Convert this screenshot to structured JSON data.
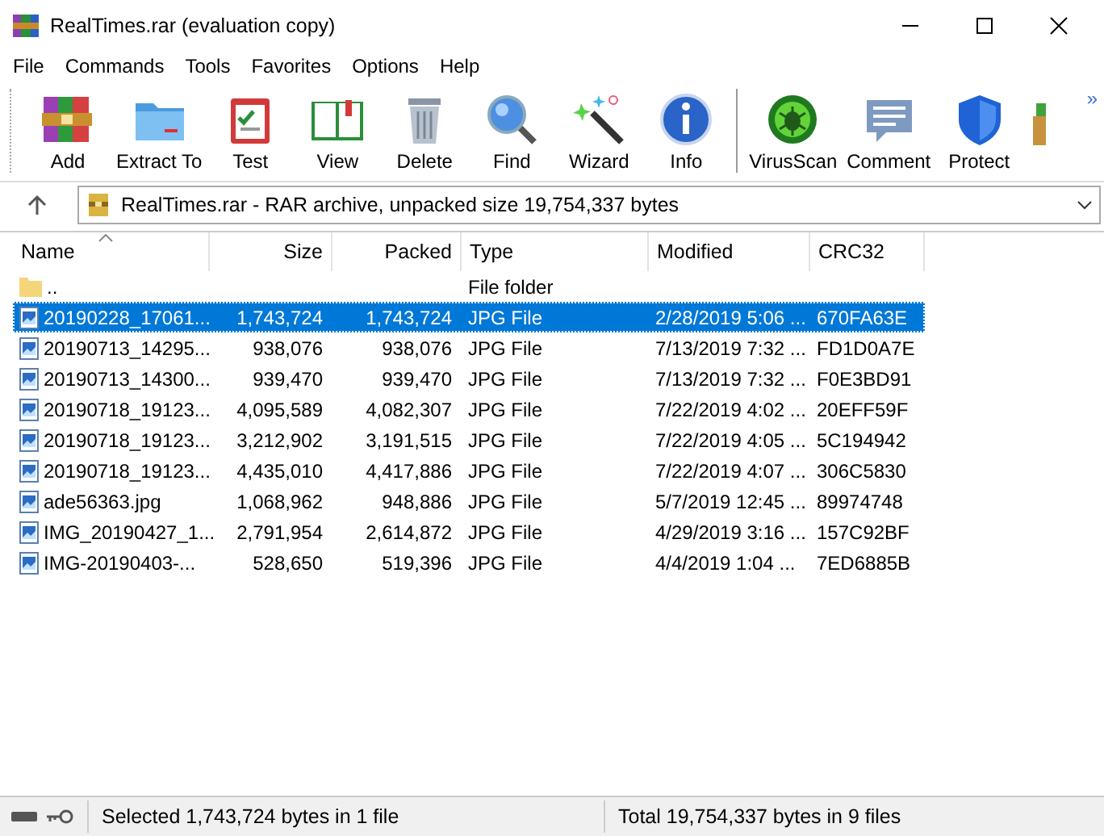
{
  "window": {
    "title": "RealTimes.rar (evaluation copy)"
  },
  "menu": [
    "File",
    "Commands",
    "Tools",
    "Favorites",
    "Options",
    "Help"
  ],
  "toolbar": [
    {
      "label": "Add"
    },
    {
      "label": "Extract To"
    },
    {
      "label": "Test"
    },
    {
      "label": "View"
    },
    {
      "label": "Delete"
    },
    {
      "label": "Find"
    },
    {
      "label": "Wizard"
    },
    {
      "label": "Info"
    },
    {
      "label": "VirusScan"
    },
    {
      "label": "Comment"
    },
    {
      "label": "Protect"
    }
  ],
  "toolbar_overflow": "»",
  "address": "RealTimes.rar - RAR archive, unpacked size 19,754,337 bytes",
  "table": {
    "columns": [
      "Name",
      "Size",
      "Packed",
      "Type",
      "Modified",
      "CRC32"
    ],
    "rows": [
      {
        "kind": "folder",
        "selected": false,
        "cells": [
          "..",
          "",
          "",
          "File folder",
          "",
          ""
        ]
      },
      {
        "kind": "file",
        "selected": true,
        "cells": [
          "20190228_17061...",
          "1,743,724",
          "1,743,724",
          "JPG File",
          "2/28/2019 5:06 ...",
          "670FA63E"
        ]
      },
      {
        "kind": "file",
        "selected": false,
        "cells": [
          "20190713_14295...",
          "938,076",
          "938,076",
          "JPG File",
          "7/13/2019 7:32 ...",
          "FD1D0A7E"
        ]
      },
      {
        "kind": "file",
        "selected": false,
        "cells": [
          "20190713_14300...",
          "939,470",
          "939,470",
          "JPG File",
          "7/13/2019 7:32 ...",
          "F0E3BD91"
        ]
      },
      {
        "kind": "file",
        "selected": false,
        "cells": [
          "20190718_19123...",
          "4,095,589",
          "4,082,307",
          "JPG File",
          "7/22/2019 4:02 ...",
          "20EFF59F"
        ]
      },
      {
        "kind": "file",
        "selected": false,
        "cells": [
          "20190718_19123...",
          "3,212,902",
          "3,191,515",
          "JPG File",
          "7/22/2019 4:05 ...",
          "5C194942"
        ]
      },
      {
        "kind": "file",
        "selected": false,
        "cells": [
          "20190718_19123...",
          "4,435,010",
          "4,417,886",
          "JPG File",
          "7/22/2019 4:07 ...",
          "306C5830"
        ]
      },
      {
        "kind": "file",
        "selected": false,
        "cells": [
          "ade56363.jpg",
          "1,068,962",
          "948,886",
          "JPG File",
          "5/7/2019 12:45 ...",
          "89974748"
        ]
      },
      {
        "kind": "file",
        "selected": false,
        "cells": [
          "IMG_20190427_1...",
          "2,791,954",
          "2,614,872",
          "JPG File",
          "4/29/2019 3:16 ...",
          "157C92BF"
        ]
      },
      {
        "kind": "file",
        "selected": false,
        "cells": [
          "IMG-20190403-...",
          "528,650",
          "519,396",
          "JPG File",
          "4/4/2019 1:04 ...",
          "7ED6885B"
        ]
      }
    ]
  },
  "status_bar": {
    "left": "Selected 1,743,724 bytes in 1 file",
    "right": "Total 19,754,337 bytes in 9 files"
  }
}
